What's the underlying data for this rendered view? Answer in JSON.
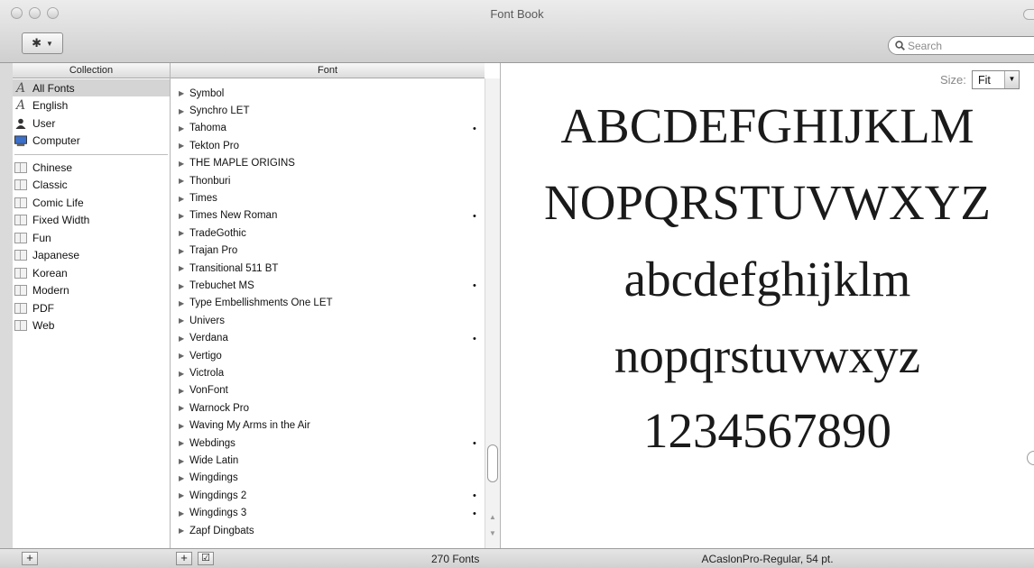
{
  "window": {
    "title": "Font Book"
  },
  "toolbar": {
    "action_icon": "gear-icon",
    "search_placeholder": "Search"
  },
  "columns": {
    "collection_header": "Collection",
    "font_header": "Font"
  },
  "collections": [
    {
      "label": "All Fonts",
      "icon": "font-icon",
      "selected": true
    },
    {
      "label": "English",
      "icon": "font-icon"
    },
    {
      "label": "User",
      "icon": "user-icon"
    },
    {
      "label": "Computer",
      "icon": "computer-icon"
    },
    {
      "label": "Chinese",
      "icon": "collection-icon"
    },
    {
      "label": "Classic",
      "icon": "collection-icon"
    },
    {
      "label": "Comic Life",
      "icon": "collection-icon"
    },
    {
      "label": "Fixed Width",
      "icon": "collection-icon"
    },
    {
      "label": "Fun",
      "icon": "collection-icon"
    },
    {
      "label": "Japanese",
      "icon": "collection-icon"
    },
    {
      "label": "Korean",
      "icon": "collection-icon"
    },
    {
      "label": "Modern",
      "icon": "collection-icon"
    },
    {
      "label": "PDF",
      "icon": "collection-icon"
    },
    {
      "label": "Web",
      "icon": "collection-icon"
    }
  ],
  "fonts": [
    {
      "name": "Symbol",
      "dot": false
    },
    {
      "name": "Synchro LET",
      "dot": false
    },
    {
      "name": "Tahoma",
      "dot": true
    },
    {
      "name": "Tekton Pro",
      "dot": false
    },
    {
      "name": "THE MAPLE ORIGINS",
      "dot": false
    },
    {
      "name": "Thonburi",
      "dot": false
    },
    {
      "name": "Times",
      "dot": false
    },
    {
      "name": "Times New Roman",
      "dot": true
    },
    {
      "name": "TradeGothic",
      "dot": false
    },
    {
      "name": "Trajan Pro",
      "dot": false
    },
    {
      "name": "Transitional 511 BT",
      "dot": false
    },
    {
      "name": "Trebuchet MS",
      "dot": true
    },
    {
      "name": "Type Embellishments One LET",
      "dot": false
    },
    {
      "name": "Univers",
      "dot": false
    },
    {
      "name": "Verdana",
      "dot": true
    },
    {
      "name": "Vertigo",
      "dot": false
    },
    {
      "name": "Victrola",
      "dot": false
    },
    {
      "name": "VonFont",
      "dot": false
    },
    {
      "name": "Warnock Pro",
      "dot": false
    },
    {
      "name": "Waving My Arms in the Air",
      "dot": false
    },
    {
      "name": "Webdings",
      "dot": true
    },
    {
      "name": "Wide Latin",
      "dot": false
    },
    {
      "name": "Wingdings",
      "dot": false
    },
    {
      "name": "Wingdings 2",
      "dot": true
    },
    {
      "name": "Wingdings 3",
      "dot": true
    },
    {
      "name": "Zapf Dingbats",
      "dot": false
    }
  ],
  "preview": {
    "size_label": "Size:",
    "size_value": "Fit",
    "lines": [
      "ABCDEFGHIJKLM",
      "NOPQRSTUVWXYZ",
      "abcdefghijklm",
      "nopqrstuvwxyz",
      "1234567890"
    ]
  },
  "status": {
    "add_collection_label": "+",
    "add_font_label": "+",
    "enable_label": "☑",
    "font_count": "270 Fonts",
    "font_info": "ACaslonPro-Regular, 54 pt."
  }
}
